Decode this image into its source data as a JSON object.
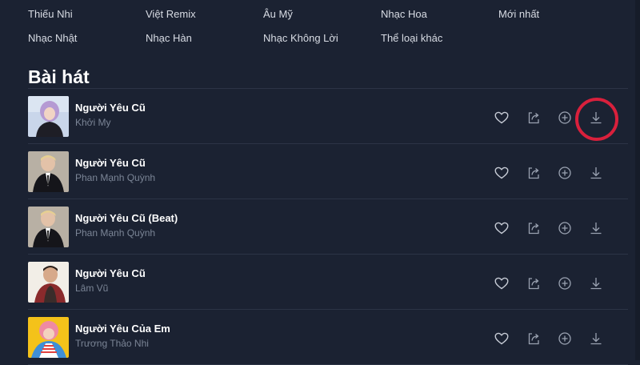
{
  "genres": [
    "Thiếu Nhi",
    "Việt Remix",
    "Âu Mỹ",
    "Nhạc Hoa",
    "Mới nhất",
    "Nhạc Nhật",
    "Nhạc Hàn",
    "Nhạc Không Lời",
    "Thể loại khác"
  ],
  "section_title": "Bài hát",
  "songs": [
    {
      "title": "Người Yêu Cũ",
      "artist": "Khởi My"
    },
    {
      "title": "Người Yêu Cũ",
      "artist": "Phan Mạnh Quỳnh"
    },
    {
      "title": "Người Yêu Cũ (Beat)",
      "artist": "Phan Mạnh Quỳnh"
    },
    {
      "title": "Người Yêu Cũ",
      "artist": "Lâm Vũ"
    },
    {
      "title": "Người Yêu Của Em",
      "artist": "Trương Thảo Nhi"
    }
  ],
  "icons": {
    "like": "heart-icon",
    "share": "share-icon",
    "add": "plus-circle-icon",
    "download": "download-icon"
  },
  "colors": {
    "background": "#1b2232",
    "icon": "#9aa2b1",
    "artist_text": "#7b8596",
    "highlight": "#d9203c"
  }
}
